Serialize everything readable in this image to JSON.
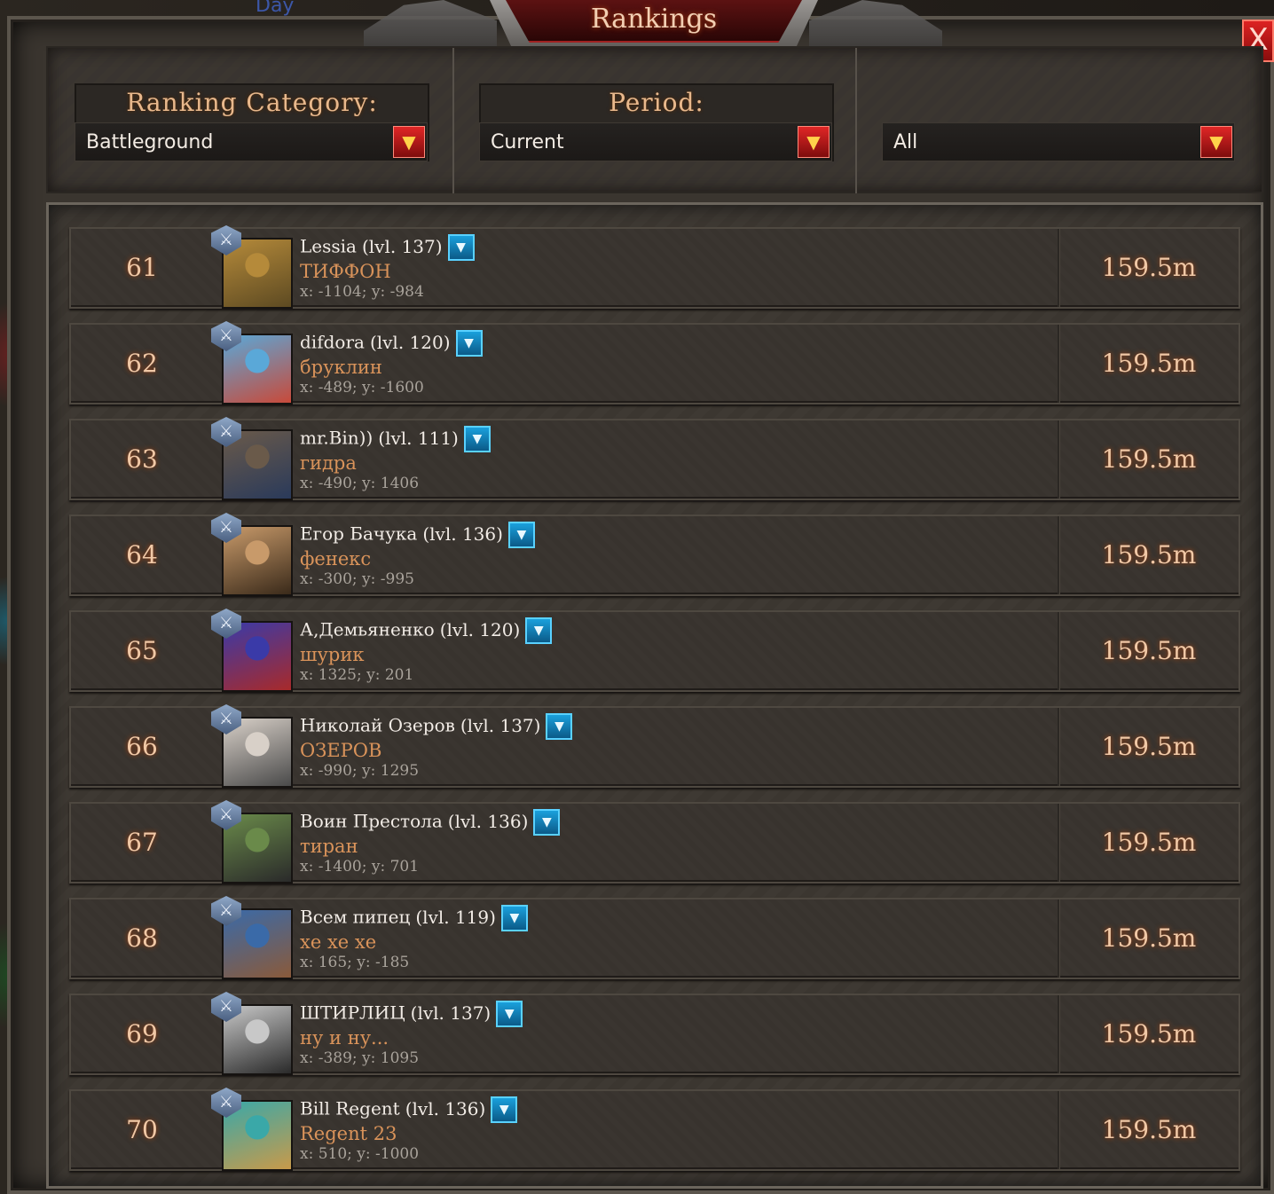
{
  "background": {
    "day_label": "Day"
  },
  "window": {
    "title": "Rankings",
    "close_label": "X"
  },
  "filters": [
    {
      "title": "Ranking Category:",
      "value": "Battleground"
    },
    {
      "title": "Period:",
      "value": "Current"
    },
    {
      "title": "",
      "value": "All"
    }
  ],
  "dropdown_glyph": "▼",
  "details_glyph": "▼",
  "badge_glyph": "⚔",
  "rows": [
    {
      "rank": "61",
      "name": "Lessia",
      "level": "(lvl. 137)",
      "alliance": "ТИФФОН",
      "coords": "x: -1104; y: -984",
      "score": "159.5m",
      "avatar_colors": [
        "#b58a3a",
        "#5d4a22"
      ]
    },
    {
      "rank": "62",
      "name": "difdora",
      "level": "(lvl. 120)",
      "alliance": "бруклин",
      "coords": "x: -489; y: -1600",
      "score": "159.5m",
      "avatar_colors": [
        "#5aa8d8",
        "#c84a3a"
      ]
    },
    {
      "rank": "63",
      "name": "mr.Bin))",
      "level": "(lvl. 111)",
      "alliance": "гидра",
      "coords": "x: -490; y: 1406",
      "score": "159.5m",
      "avatar_colors": [
        "#6a5a4a",
        "#2a3a5a"
      ]
    },
    {
      "rank": "64",
      "name": "Егор Бачука",
      "level": "(lvl. 136)",
      "alliance": "фенекс",
      "coords": "x: -300; y: -995",
      "score": "159.5m",
      "avatar_colors": [
        "#c89a6a",
        "#3a2a1a"
      ]
    },
    {
      "rank": "65",
      "name": "А,Демьяненко",
      "level": "(lvl. 120)",
      "alliance": "шурик",
      "coords": "x: 1325; y: 201",
      "score": "159.5m",
      "avatar_colors": [
        "#3a3aa8",
        "#a82a2a"
      ]
    },
    {
      "rank": "66",
      "name": "Николай Озеров",
      "level": "(lvl. 137)",
      "alliance": "ОЗЕРОВ",
      "coords": "x: -990; y: 1295",
      "score": "159.5m",
      "avatar_colors": [
        "#d8d0c8",
        "#4a4a4a"
      ]
    },
    {
      "rank": "67",
      "name": "Воин Престола",
      "level": "(lvl. 136)",
      "alliance": "тиран",
      "coords": "x: -1400; y: 701",
      "score": "159.5m",
      "avatar_colors": [
        "#6a8a4a",
        "#2a2a2a"
      ]
    },
    {
      "rank": "68",
      "name": "Всем пипец",
      "level": "(lvl. 119)",
      "alliance": "хе хе хе",
      "coords": "x: 165; y: -185",
      "score": "159.5m",
      "avatar_colors": [
        "#3a6aa8",
        "#8a5a3a"
      ]
    },
    {
      "rank": "69",
      "name": "ШТИРЛИЦ",
      "level": "(lvl. 137)",
      "alliance": "ну и ну...",
      "coords": "x: -389; y: 1095",
      "score": "159.5m",
      "avatar_colors": [
        "#c8c8c8",
        "#2a2a2a"
      ]
    },
    {
      "rank": "70",
      "name": "Bill Regent",
      "level": "(lvl. 136)",
      "alliance": "Regent 23",
      "coords": "x: 510; y: -1000",
      "score": "159.5m",
      "avatar_colors": [
        "#3aa8a8",
        "#c89a4a"
      ]
    }
  ]
}
